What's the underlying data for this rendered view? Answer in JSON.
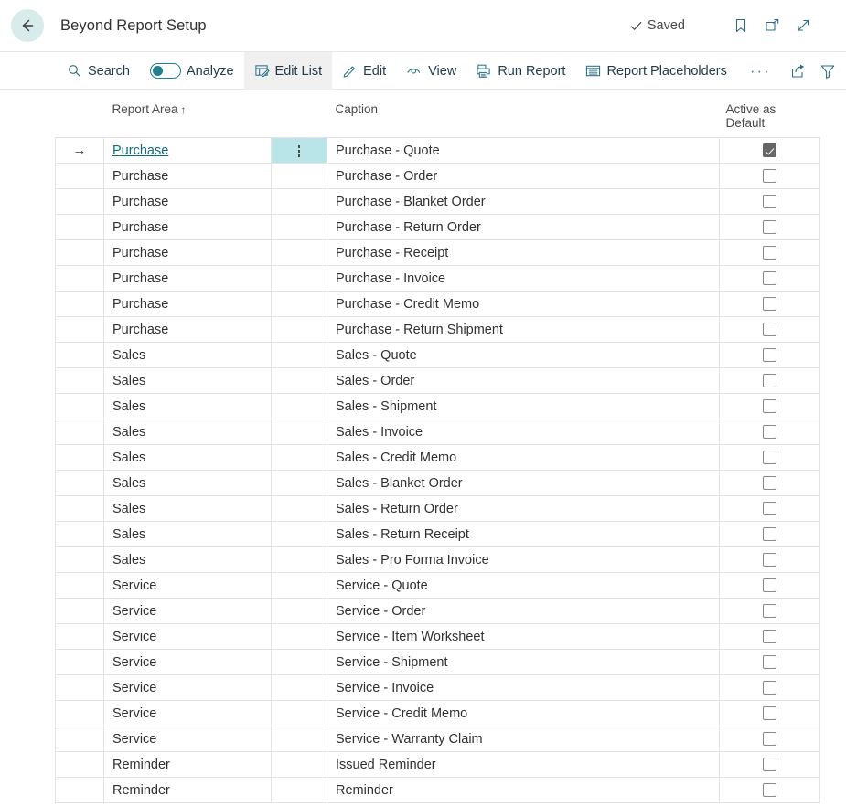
{
  "header": {
    "back_icon": "back-arrow-icon",
    "title": "Beyond Report Setup",
    "saved_label": "Saved",
    "saved_icon": "checkmark-icon",
    "bookmark_icon": "bookmark-icon",
    "open_new_window_icon": "open-in-new-window-icon",
    "expand_icon": "expand-diagonal-icon"
  },
  "toolbar": {
    "search_label": "Search",
    "search_icon": "search-icon",
    "analyze_label": "Analyze",
    "analyze_toggle_on": false,
    "edit_list_label": "Edit List",
    "edit_list_icon": "edit-list-icon",
    "edit_label": "Edit",
    "edit_icon": "pencil-icon",
    "view_label": "View",
    "view_icon": "eye-icon",
    "run_report_label": "Run Report",
    "run_report_icon": "printer-icon",
    "report_placeholders_label": "Report Placeholders",
    "report_placeholders_icon": "list-box-icon",
    "more_label": "···",
    "share_icon": "share-icon",
    "filter_icon": "funnel-filter-icon",
    "list_view_icon": "list-lines-icon"
  },
  "table": {
    "columns": {
      "report_area": "Report Area",
      "report_area_sort": "↑",
      "caption": "Caption",
      "active_as_default_line1": "Active as",
      "active_as_default_line2": "Default"
    },
    "rows": [
      {
        "area": "Purchase",
        "caption": "Purchase - Quote",
        "checked": true,
        "selected": true
      },
      {
        "area": "Purchase",
        "caption": "Purchase - Order",
        "checked": false,
        "selected": false
      },
      {
        "area": "Purchase",
        "caption": "Purchase - Blanket Order",
        "checked": false,
        "selected": false
      },
      {
        "area": "Purchase",
        "caption": "Purchase - Return Order",
        "checked": false,
        "selected": false
      },
      {
        "area": "Purchase",
        "caption": "Purchase - Receipt",
        "checked": false,
        "selected": false
      },
      {
        "area": "Purchase",
        "caption": "Purchase - Invoice",
        "checked": false,
        "selected": false
      },
      {
        "area": "Purchase",
        "caption": "Purchase - Credit Memo",
        "checked": false,
        "selected": false
      },
      {
        "area": "Purchase",
        "caption": "Purchase - Return Shipment",
        "checked": false,
        "selected": false
      },
      {
        "area": "Sales",
        "caption": "Sales - Quote",
        "checked": false,
        "selected": false
      },
      {
        "area": "Sales",
        "caption": "Sales - Order",
        "checked": false,
        "selected": false
      },
      {
        "area": "Sales",
        "caption": "Sales - Shipment",
        "checked": false,
        "selected": false
      },
      {
        "area": "Sales",
        "caption": "Sales - Invoice",
        "checked": false,
        "selected": false
      },
      {
        "area": "Sales",
        "caption": "Sales - Credit Memo",
        "checked": false,
        "selected": false
      },
      {
        "area": "Sales",
        "caption": "Sales - Blanket Order",
        "checked": false,
        "selected": false
      },
      {
        "area": "Sales",
        "caption": "Sales - Return Order",
        "checked": false,
        "selected": false
      },
      {
        "area": "Sales",
        "caption": "Sales - Return Receipt",
        "checked": false,
        "selected": false
      },
      {
        "area": "Sales",
        "caption": "Sales - Pro Forma Invoice",
        "checked": false,
        "selected": false
      },
      {
        "area": "Service",
        "caption": "Service - Quote",
        "checked": false,
        "selected": false
      },
      {
        "area": "Service",
        "caption": "Service - Order",
        "checked": false,
        "selected": false
      },
      {
        "area": "Service",
        "caption": "Service - Item Worksheet",
        "checked": false,
        "selected": false
      },
      {
        "area": "Service",
        "caption": "Service - Shipment",
        "checked": false,
        "selected": false
      },
      {
        "area": "Service",
        "caption": "Service - Invoice",
        "checked": false,
        "selected": false
      },
      {
        "area": "Service",
        "caption": "Service - Credit Memo",
        "checked": false,
        "selected": false
      },
      {
        "area": "Service",
        "caption": "Service - Warranty Claim",
        "checked": false,
        "selected": false
      },
      {
        "area": "Reminder",
        "caption": "Issued Reminder",
        "checked": false,
        "selected": false
      },
      {
        "area": "Reminder",
        "caption": "Reminder",
        "checked": false,
        "selected": false
      }
    ]
  },
  "colors": {
    "accent_teal": "#20808d",
    "selected_cell": "#b9e4e8",
    "link": "#0f6c7a",
    "back_button_bg": "#d9ecec",
    "toolbar_icon": "#2a6f85",
    "active_tab_bg": "#f0f0f0"
  }
}
